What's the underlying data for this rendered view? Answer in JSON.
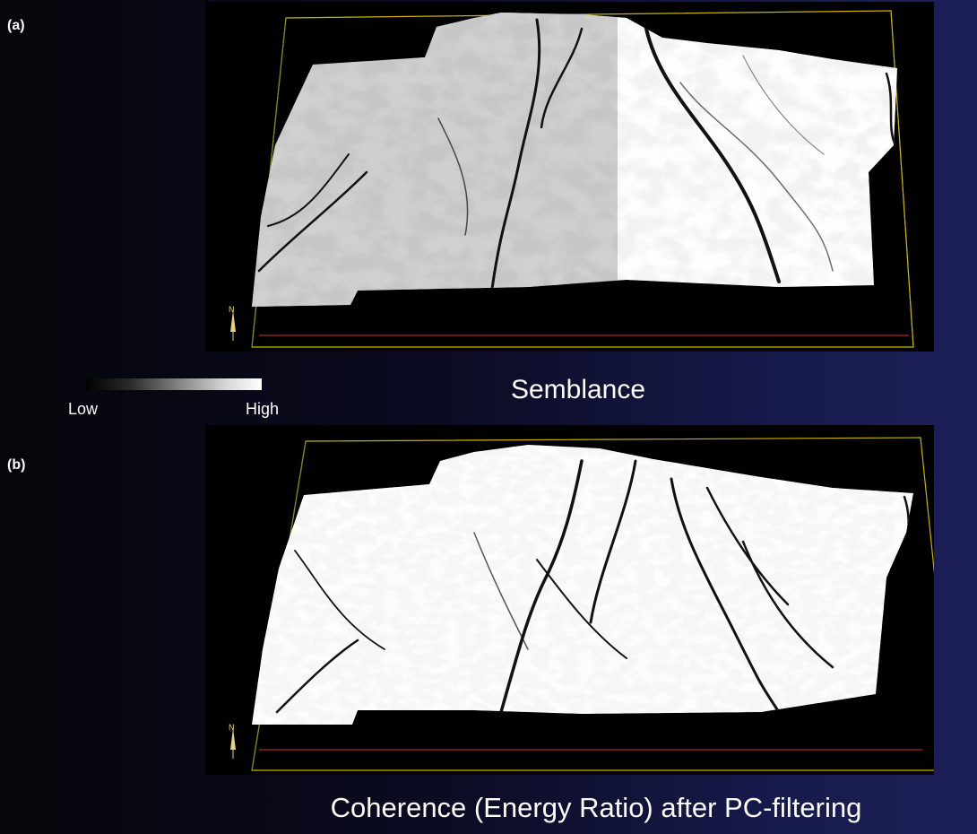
{
  "panels": [
    {
      "label": "(a)",
      "caption": "Semblance"
    },
    {
      "label": "(b)",
      "caption": "Coherence (Energy Ratio) after PC-filtering"
    }
  ],
  "colorbar": {
    "low": "Low",
    "high": "High"
  },
  "north_arrow": {
    "label": "N"
  },
  "colors": {
    "box_edge": "#c8b400",
    "box_back": "#6b8f2a",
    "box_front": "#b0261c"
  }
}
